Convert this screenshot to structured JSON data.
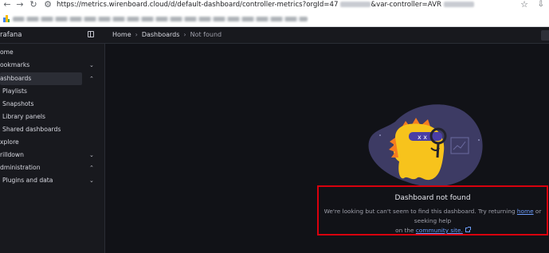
{
  "browser": {
    "url": "https://metrics.wirenboard.cloud/d/default-dashboard/controller-metrics?orgId=47",
    "url_suffix": "&var-controller=AVR",
    "back_icon": "arrow-left-icon",
    "forward_icon": "arrow-right-icon",
    "reload_icon": "reload-icon",
    "site_info_icon": "site-info-icon",
    "bookmark_star_icon": "star-icon",
    "download_icon": "download-icon"
  },
  "topbar": {
    "brand": "rafana",
    "breadcrumb": [
      "Home",
      "Dashboards",
      "Not found"
    ]
  },
  "sidebar": {
    "items": [
      {
        "label": "ome",
        "chevron": ""
      },
      {
        "label": "ookmarks",
        "chevron": "⌄"
      },
      {
        "label": "ashboards",
        "chevron": "⌃",
        "active": true
      },
      {
        "label": "Playlists",
        "chevron": "",
        "child": true
      },
      {
        "label": "Snapshots",
        "chevron": "",
        "child": true
      },
      {
        "label": "Library panels",
        "chevron": "",
        "child": true
      },
      {
        "label": "Shared dashboards",
        "chevron": "",
        "child": true
      },
      {
        "label": "xplore",
        "chevron": ""
      },
      {
        "label": "rilldown",
        "chevron": "⌄"
      },
      {
        "label": "dministration",
        "chevron": "⌃"
      },
      {
        "label": "Plugins and data",
        "chevron": "⌄",
        "child": true
      }
    ]
  },
  "not_found": {
    "title": "Dashboard not found",
    "body_pre": "We're looking but can't seem to find this dashboard. Try returning",
    "home_link": "home",
    "body_mid": "or seeking help",
    "body_on": "on the",
    "community_link": "community site.",
    "mascot_eyes": "x x"
  },
  "colors": {
    "accent_link": "#6e9fff",
    "highlight_border": "#d9000d",
    "mascot_body": "#f7c31c",
    "mascot_spikes": "#f57c20",
    "blob": "#3d3b64"
  }
}
